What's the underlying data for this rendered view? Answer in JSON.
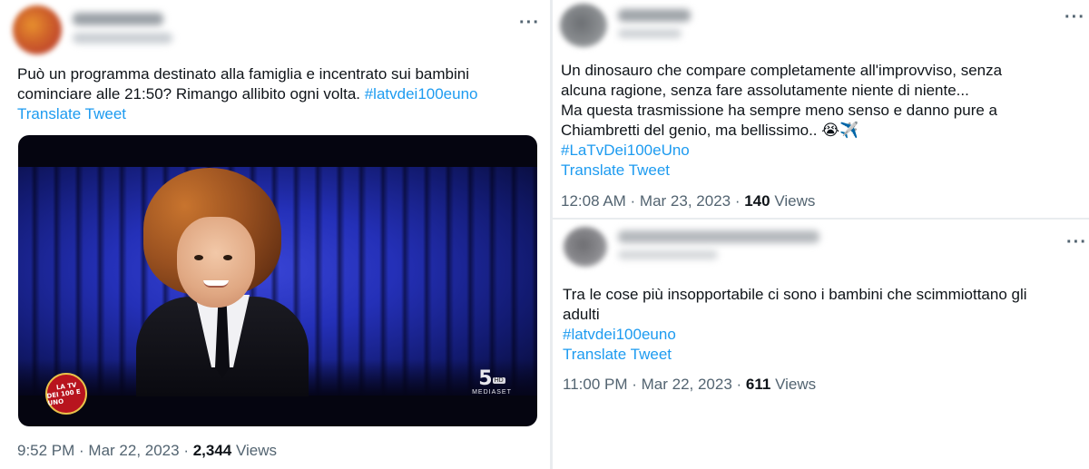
{
  "tweets": [
    {
      "lines": [
        "Può un programma destinato alla famiglia e incentrato sui bambini",
        "cominciare alle 21:50? Rimango allibito ogni volta. "
      ],
      "hashtag": "#latvdei100euno",
      "translate": "Translate Tweet",
      "time": "9:52 PM · Mar 22, 2023 · ",
      "views_count": "2,344",
      "views_label": " Views",
      "media": {
        "badge_line1": "LA TV",
        "badge_line2": "DEI 100 E UNO",
        "channel_number": "5",
        "channel_hd": "HD",
        "channel_brand": "MEDIASET"
      }
    },
    {
      "lines": [
        "Un dinosauro che compare completamente all'improvviso, senza",
        "alcuna ragione, senza fare assolutamente niente di niente...",
        "Ma questa trasmissione ha sempre meno senso e danno pure a",
        "Chiambretti del genio, ma bellissimo.. 😭✈️"
      ],
      "hashtag": "#LaTvDei100eUno",
      "translate": "Translate Tweet",
      "time": "12:08 AM · Mar 23, 2023 · ",
      "views_count": "140",
      "views_label": " Views"
    },
    {
      "lines": [
        "Tra le cose più insopportabile ci sono i bambini che scimmiottano gli",
        "adulti"
      ],
      "hashtag": "#latvdei100euno",
      "translate": "Translate Tweet",
      "time": "11:00 PM · Mar 22, 2023 · ",
      "views_count": "611",
      "views_label": " Views"
    }
  ],
  "icons": {
    "more": "···",
    "more_icon": "more-horizontal-icon"
  },
  "colors": {
    "link": "#1d9bf0",
    "meta": "#536471",
    "text": "#0f1419"
  }
}
